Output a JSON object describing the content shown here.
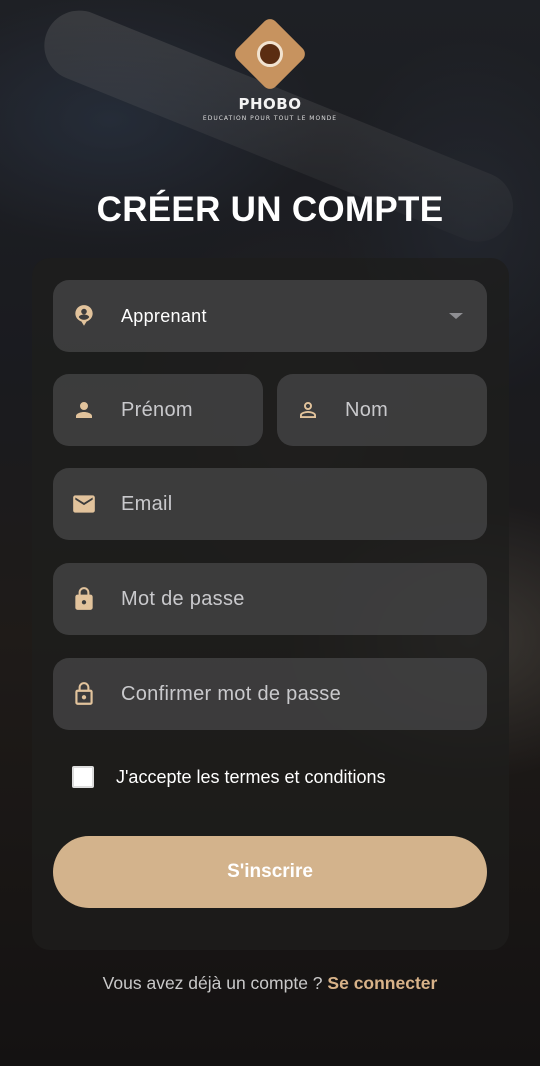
{
  "brand": {
    "name": "PHOBO",
    "tagline": "EDUCATION POUR TOUT LE MONDE"
  },
  "page_title": "CRÉER UN COMPTE",
  "form": {
    "role_select": {
      "value": "Apprenant",
      "icon": "account-pin-icon"
    },
    "first_name": {
      "placeholder": "Prénom",
      "icon": "person-filled-icon"
    },
    "last_name": {
      "placeholder": "Nom",
      "icon": "person-outline-icon"
    },
    "email": {
      "placeholder": "Email",
      "icon": "mail-icon"
    },
    "password": {
      "placeholder": "Mot de passe",
      "icon": "lock-filled-icon"
    },
    "confirm_password": {
      "placeholder": "Confirmer mot de passe",
      "icon": "lock-outline-icon"
    },
    "terms": {
      "label": "J'accepte les termes et conditions",
      "checked": false
    },
    "submit_label": "S'inscrire"
  },
  "footer": {
    "prompt": "Vous avez déjà un compte ?",
    "link": "Se connecter"
  },
  "colors": {
    "accent": "#D3B38C",
    "icon": "#E2C39C",
    "link": "#D8B389",
    "field_bg": "#48484A",
    "card_bg": "#1E1D1C"
  }
}
